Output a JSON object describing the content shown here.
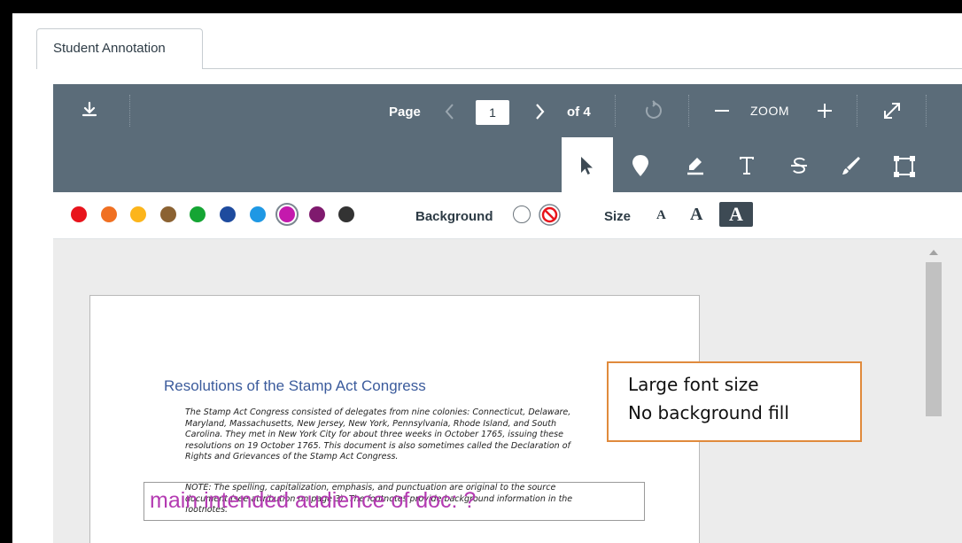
{
  "tab": {
    "label": "Student Annotation"
  },
  "toolbar": {
    "page_label": "Page",
    "page_value": "1",
    "page_total": "of 4",
    "zoom_label": "ZOOM"
  },
  "colors": {
    "swatches": [
      "#e8141c",
      "#f07022",
      "#fcb51b",
      "#8b6232",
      "#15a534",
      "#1e4b9e",
      "#1f98e4",
      "#c419ad",
      "#7f1a6e",
      "#333333"
    ],
    "selected": "#c419ad"
  },
  "colorbar": {
    "background_label": "Background",
    "size_label": "Size",
    "size_small": "A",
    "size_medium": "A",
    "size_large": "A"
  },
  "document": {
    "title": "Resolutions of the Stamp Act Congress",
    "intro": "The Stamp Act Congress consisted of delegates from nine colonies: Connecticut, Delaware, Maryland, Massachusetts, New Jersey, New York, Pennsylvania, Rhode Island, and South Carolina. They met in New York City for about three weeks in October 1765, issuing these resolutions on 19 October 1765. This document is also sometimes called the Declaration of Rights and Grievances of the Stamp Act Congress.",
    "note": "NOTE: The spelling, capitalization, emphasis, and punctuation are original to the source document (see attribution on page 3). The footnotes provide background information in the footnotes."
  },
  "annotation": {
    "text": "main intended audience of doc: ?"
  },
  "callout": {
    "line1": "Large font size",
    "line2": "No background fill"
  }
}
